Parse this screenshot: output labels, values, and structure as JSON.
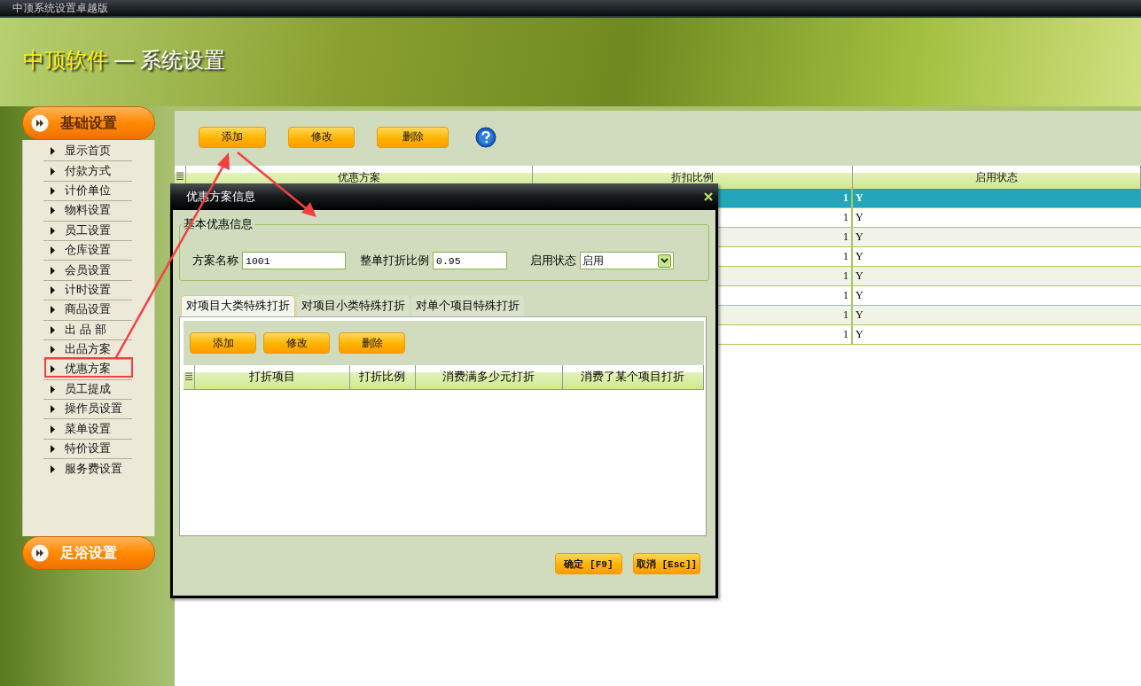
{
  "window": {
    "title": "中顶系统设置卓越版"
  },
  "header": {
    "brand": "中顶软件",
    "separator": "—",
    "title": "系统设置"
  },
  "sidebar": {
    "sections": [
      {
        "label": "基础设置",
        "expanded": true,
        "items": [
          "显示首页",
          "付款方式",
          "计价单位",
          "物料设置",
          "员工设置",
          "仓库设置",
          "会员设置",
          "计时设置",
          "商品设置",
          "出 品 部",
          "出品方案",
          "优惠方案",
          "员工提成",
          "操作员设置",
          "菜单设置",
          "特价设置",
          "服务费设置"
        ]
      },
      {
        "label": "足浴设置",
        "expanded": false
      }
    ]
  },
  "toolbar": {
    "buttons": [
      "添加",
      "修改",
      "删除"
    ]
  },
  "table": {
    "columns": [
      "优惠方案",
      "折扣比例",
      "启用状态"
    ],
    "rows": [
      {
        "discount_ratio": "1",
        "status": "Y",
        "selected": true
      },
      {
        "discount_ratio": "1",
        "status": "Y",
        "selected": false
      },
      {
        "discount_ratio": "1",
        "status": "Y",
        "selected": false
      },
      {
        "discount_ratio": "1",
        "status": "Y",
        "selected": false
      },
      {
        "discount_ratio": "1",
        "status": "Y",
        "selected": false
      },
      {
        "discount_ratio": "1",
        "status": "Y",
        "selected": false
      },
      {
        "discount_ratio": "1",
        "status": "Y",
        "selected": false
      },
      {
        "discount_ratio": "1",
        "status": "Y",
        "selected": false
      }
    ]
  },
  "dialog": {
    "title": "优惠方案信息",
    "group": {
      "legend": "基本优惠信息",
      "fields": [
        {
          "kind": "text",
          "label": "方案名称",
          "value": "1001"
        },
        {
          "kind": "text",
          "label": "整单打折比例",
          "value": "0.95"
        },
        {
          "kind": "select",
          "label": "启用状态",
          "value": "启用"
        }
      ]
    },
    "tabs": [
      {
        "label": "对项目大类特殊打折",
        "selected": true
      },
      {
        "label": "对项目小类特殊打折",
        "selected": false
      },
      {
        "label": "对单个项目特殊打折",
        "selected": false
      }
    ],
    "tab_toolbar": [
      "添加",
      "修改",
      "删除"
    ],
    "grid": {
      "columns": [
        "打折项目",
        "打折比例",
        "消费满多少元打折",
        "消费了某个项目打折"
      ]
    },
    "buttons": [
      "确定 [F9]",
      "取消 [Esc]]"
    ]
  }
}
